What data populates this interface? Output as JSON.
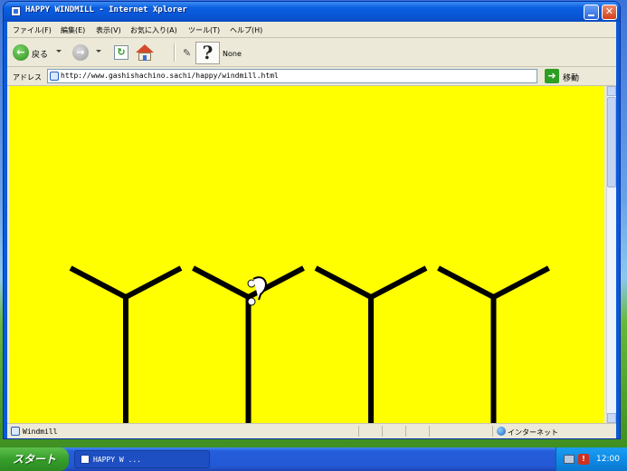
{
  "window": {
    "title": "HAPPY WINDMILL - Internet Xplorer"
  },
  "menu": {
    "items": [
      "ファイル(F)",
      "編集(E)",
      "表示(V)",
      "お気に入り(A)",
      "ツール(T)",
      "ヘルプ(H)"
    ]
  },
  "toolbar": {
    "back_label": "戻る",
    "back_icon": "back-arrow-icon",
    "forward_icon": "forward-arrow-icon",
    "refresh_icon": "refresh-icon",
    "home_icon": "home-icon",
    "pen_tool_glyph": "?",
    "pen_tool_label": "None"
  },
  "address": {
    "label": "アドレス",
    "url": "http://www.gashishachino.sachi/happy/windmill.html",
    "go_label": "移動"
  },
  "page": {
    "background_color": "#ffff00",
    "windmill_count": 4,
    "windmill_color": "#000000"
  },
  "status": {
    "text": "Windmill",
    "zone": "インターネット"
  },
  "taskbar": {
    "start_label": "スタート",
    "task_label": "HAPPY W ...",
    "clock": "12:00"
  }
}
